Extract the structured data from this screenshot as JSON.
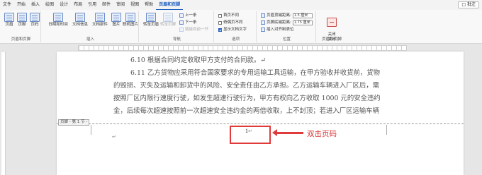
{
  "tabs": [
    "文件",
    "开始",
    "插入",
    "绘图",
    "设计",
    "布局",
    "引用",
    "邮件",
    "审阅",
    "视图",
    "帮助",
    "页眉和页脚"
  ],
  "active_tab_index": 11,
  "comment_label": "批注",
  "groups": {
    "header_footer": {
      "label": "页眉和页脚",
      "buttons": [
        "页眉",
        "页脚",
        "页码"
      ]
    },
    "insert": {
      "label": "插入",
      "buttons": [
        "日期和时间",
        "文档信息",
        "文档部件",
        "图片",
        "联机图片"
      ]
    },
    "navigation": {
      "label": "导航",
      "goto_header": "转至页眉",
      "goto_footer": "转至页脚",
      "prev": "上一条",
      "next": "下一条",
      "link_prev": "链接到前一节"
    },
    "options": {
      "label": "选项",
      "first_page_diff": "首页不同",
      "odd_even_diff": "奇偶页不同",
      "show_doc_text": "显示文档文字"
    },
    "position": {
      "label": "位置",
      "header_top": "页眉顶端距离:",
      "footer_bottom": "页脚底端距离:",
      "header_top_value": "1.5 厘米",
      "footer_bottom_value": "1.75 厘米",
      "insert_align_tab": "插入对齐制表位"
    },
    "close": {
      "label": "关闭",
      "button": "关闭\n页眉和页脚"
    }
  },
  "document": {
    "lines": [
      "6.10   根据合同约定收取甲方支付的合同款。↵",
      "6.11   乙方货物应采用符合国家要求的专用运输工具运输，在甲方验收并收货前，货物",
      "的毁损、灭失及运输和卸货中的风险、安全责任由乙方承担。乙方运输车辆进入厂区后，需",
      "按照厂区内限行速度行驶，如发生超速行驶行为，甲方有权向乙方收取 1000 元的安全违约",
      "金，后续每次超速按照前一次超速安全违约金的两倍收取，上不封顶；若进入厂区运输车辆"
    ],
    "footer_tag": "页脚 - 第 1 节 -",
    "page_number": "1",
    "return_mark": "↵"
  },
  "annotation": {
    "text": "双击页码",
    "color": "#e03a3a"
  }
}
